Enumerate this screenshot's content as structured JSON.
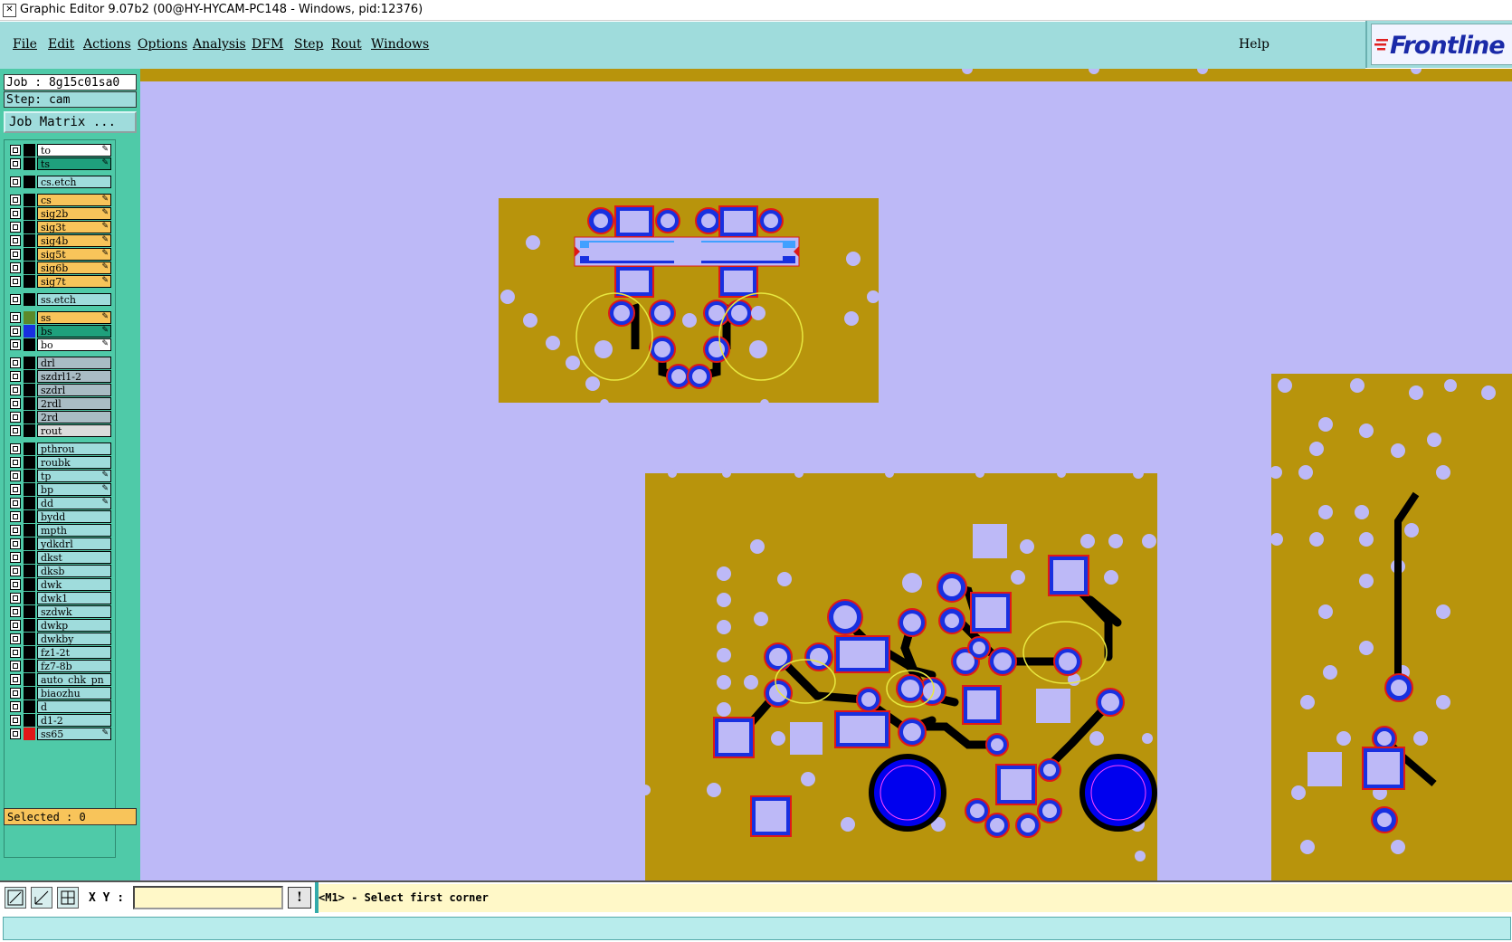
{
  "window": {
    "title": "Graphic Editor 9.07b2 (00@HY-HYCAM-PC148 - Windows, pid:12376)"
  },
  "menu": [
    {
      "label": "File"
    },
    {
      "label": "Edit"
    },
    {
      "label": "Actions"
    },
    {
      "label": "Options"
    },
    {
      "label": "Analysis"
    },
    {
      "label": "DFM"
    },
    {
      "label": "Step"
    },
    {
      "label": "Rout"
    },
    {
      "label": "Windows"
    }
  ],
  "help_label": "Help",
  "logo_text": "Frontline",
  "job": {
    "label": "Job : 8g15c01sa0",
    "step": "Step: cam",
    "matrix_button": "Job Matrix ..."
  },
  "layers": [
    {
      "name": "to",
      "bg": "#ffffff",
      "swatch": "#000000",
      "edit": true
    },
    {
      "name": "ts",
      "bg": "#1fa07c",
      "swatch": "#000000",
      "edit": true
    },
    {
      "name": "cs.etch",
      "bg": "#9fdcdc",
      "swatch": "#000000",
      "edit": false
    },
    {
      "name": "cs",
      "bg": "#f8c45a",
      "swatch": "#000000",
      "edit": true
    },
    {
      "name": "sig2b",
      "bg": "#f8c45a",
      "swatch": "#000000",
      "edit": true
    },
    {
      "name": "sig3t",
      "bg": "#f8c45a",
      "swatch": "#000000",
      "edit": true
    },
    {
      "name": "sig4b",
      "bg": "#f8c45a",
      "swatch": "#000000",
      "edit": true
    },
    {
      "name": "sig5t",
      "bg": "#f8c45a",
      "swatch": "#000000",
      "edit": true
    },
    {
      "name": "sig6b",
      "bg": "#f8c45a",
      "swatch": "#000000",
      "edit": true
    },
    {
      "name": "sig7t",
      "bg": "#f8c45a",
      "swatch": "#000000",
      "edit": true
    },
    {
      "name": "ss.etch",
      "bg": "#9fdcdc",
      "swatch": "#000000",
      "edit": false
    },
    {
      "name": "ss",
      "bg": "#f8c45a",
      "swatch": "#5c8a2a",
      "edit": true
    },
    {
      "name": "bs",
      "bg": "#1fa07c",
      "swatch": "#1830e0",
      "edit": true
    },
    {
      "name": "bo",
      "bg": "#ffffff",
      "swatch": "#000000",
      "edit": true
    },
    {
      "name": "drl",
      "bg": "#a9bcc4",
      "swatch": "#000000",
      "edit": false
    },
    {
      "name": "szdrl1-2",
      "bg": "#a9bcc4",
      "swatch": "#000000",
      "edit": false
    },
    {
      "name": "szdrl",
      "bg": "#a9bcc4",
      "swatch": "#000000",
      "edit": false
    },
    {
      "name": "2rdl",
      "bg": "#a9bcc4",
      "swatch": "#000000",
      "edit": false
    },
    {
      "name": "2rd",
      "bg": "#a9bcc4",
      "swatch": "#000000",
      "edit": false
    },
    {
      "name": "rout",
      "bg": "#dcdcdc",
      "swatch": "#000000",
      "edit": false
    },
    {
      "name": "pthrou",
      "bg": "#9fdcdc",
      "swatch": "#000000",
      "edit": false
    },
    {
      "name": "roubk",
      "bg": "#9fdcdc",
      "swatch": "#000000",
      "edit": false
    },
    {
      "name": "tp",
      "bg": "#9fdcdc",
      "swatch": "#000000",
      "edit": true
    },
    {
      "name": "bp",
      "bg": "#9fdcdc",
      "swatch": "#000000",
      "edit": true
    },
    {
      "name": "dd",
      "bg": "#9fdcdc",
      "swatch": "#000000",
      "edit": true
    },
    {
      "name": "bydd",
      "bg": "#9fdcdc",
      "swatch": "#000000",
      "edit": false
    },
    {
      "name": "mpth",
      "bg": "#9fdcdc",
      "swatch": "#000000",
      "edit": false
    },
    {
      "name": "ydkdrl",
      "bg": "#9fdcdc",
      "swatch": "#000000",
      "edit": false
    },
    {
      "name": "dkst",
      "bg": "#9fdcdc",
      "swatch": "#000000",
      "edit": false
    },
    {
      "name": "dksb",
      "bg": "#9fdcdc",
      "swatch": "#000000",
      "edit": false
    },
    {
      "name": "dwk",
      "bg": "#9fdcdc",
      "swatch": "#000000",
      "edit": false
    },
    {
      "name": "dwk1",
      "bg": "#9fdcdc",
      "swatch": "#000000",
      "edit": false
    },
    {
      "name": "szdwk",
      "bg": "#9fdcdc",
      "swatch": "#000000",
      "edit": false
    },
    {
      "name": "dwkp",
      "bg": "#9fdcdc",
      "swatch": "#000000",
      "edit": false
    },
    {
      "name": "dwkby",
      "bg": "#9fdcdc",
      "swatch": "#000000",
      "edit": false
    },
    {
      "name": "fz1-2t",
      "bg": "#9fdcdc",
      "swatch": "#000000",
      "edit": false
    },
    {
      "name": "fz7-8b",
      "bg": "#9fdcdc",
      "swatch": "#000000",
      "edit": false
    },
    {
      "name": "auto_chk_pn",
      "bg": "#9fdcdc",
      "swatch": "#000000",
      "edit": false
    },
    {
      "name": "biaozhu",
      "bg": "#9fdcdc",
      "swatch": "#000000",
      "edit": false
    },
    {
      "name": "d",
      "bg": "#9fdcdc",
      "swatch": "#000000",
      "edit": false
    },
    {
      "name": "d1-2",
      "bg": "#9fdcdc",
      "swatch": "#000000",
      "edit": false
    },
    {
      "name": "ss65",
      "bg": "#9fdcdc",
      "swatch": "#e01818",
      "edit": true
    }
  ],
  "selected_label": "Selected : 0",
  "status": {
    "xy_label": "X Y :",
    "xy_value": "",
    "warn_label": "!",
    "prompt": "<M1> - Select first corner"
  }
}
